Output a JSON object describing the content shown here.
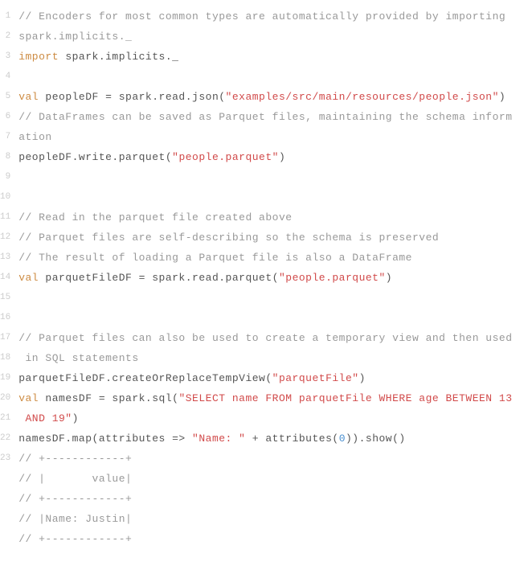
{
  "chart_data": {
    "type": "table",
    "title": "Scala / Spark code snippet",
    "code_lines": [
      {
        "n": 1,
        "segs": [
          {
            "cls": "c-comment",
            "t": "// Encoders for most common types are automatically provided by importing "
          }
        ]
      },
      {
        "n": 2,
        "segs": [
          {
            "cls": "c-comment",
            "t": "spark.implicits._"
          }
        ]
      },
      {
        "n": 3,
        "segs": [
          {
            "cls": "c-keyword",
            "t": "import"
          },
          {
            "cls": "c-plain",
            "t": " spark.implicits._"
          }
        ]
      },
      {
        "n": 4,
        "segs": [
          {
            "cls": "c-plain",
            "t": ""
          }
        ]
      },
      {
        "n": 5,
        "segs": [
          {
            "cls": "c-keyword",
            "t": "val"
          },
          {
            "cls": "c-plain",
            "t": " peopleDF = spark.read.json("
          },
          {
            "cls": "c-string",
            "t": "\"examples/src/main/resources/people.json\""
          },
          {
            "cls": "c-plain",
            "t": ")"
          }
        ]
      },
      {
        "n": 6,
        "segs": [
          {
            "cls": "c-comment",
            "t": "// DataFrames can be saved as Parquet files, maintaining the schema inform"
          }
        ]
      },
      {
        "n": 7,
        "segs": [
          {
            "cls": "c-comment",
            "t": "ation"
          }
        ]
      },
      {
        "n": 8,
        "segs": [
          {
            "cls": "c-plain",
            "t": "peopleDF.write.parquet("
          },
          {
            "cls": "c-string",
            "t": "\"people.parquet\""
          },
          {
            "cls": "c-plain",
            "t": ")"
          }
        ]
      },
      {
        "n": 9,
        "segs": [
          {
            "cls": "c-plain",
            "t": ""
          }
        ]
      },
      {
        "n": 10,
        "segs": [
          {
            "cls": "c-plain",
            "t": ""
          }
        ]
      },
      {
        "n": 11,
        "segs": [
          {
            "cls": "c-comment",
            "t": "// Read in the parquet file created above"
          }
        ]
      },
      {
        "n": 12,
        "segs": [
          {
            "cls": "c-comment",
            "t": "// Parquet files are self-describing so the schema is preserved"
          }
        ]
      },
      {
        "n": 13,
        "segs": [
          {
            "cls": "c-comment",
            "t": "// The result of loading a Parquet file is also a DataFrame"
          }
        ]
      },
      {
        "n": 14,
        "segs": [
          {
            "cls": "c-keyword",
            "t": "val"
          },
          {
            "cls": "c-plain",
            "t": " parquetFileDF = spark.read.parquet("
          },
          {
            "cls": "c-string",
            "t": "\"people.parquet\""
          },
          {
            "cls": "c-plain",
            "t": ")"
          }
        ]
      },
      {
        "n": 15,
        "segs": [
          {
            "cls": "c-plain",
            "t": ""
          }
        ]
      },
      {
        "n": 16,
        "segs": [
          {
            "cls": "c-plain",
            "t": ""
          }
        ]
      },
      {
        "n": 17,
        "segs": [
          {
            "cls": "c-comment",
            "t": "// Parquet files can also be used to create a temporary view and then used"
          }
        ]
      },
      {
        "n": 18,
        "segs": [
          {
            "cls": "c-comment",
            "t": " in SQL statements"
          }
        ]
      },
      {
        "n": 19,
        "segs": [
          {
            "cls": "c-plain",
            "t": "parquetFileDF.createOrReplaceTempView("
          },
          {
            "cls": "c-string",
            "t": "\"parquetFile\""
          },
          {
            "cls": "c-plain",
            "t": ")"
          }
        ]
      },
      {
        "n": 20,
        "segs": [
          {
            "cls": "c-keyword",
            "t": "val"
          },
          {
            "cls": "c-plain",
            "t": " namesDF = spark.sql("
          },
          {
            "cls": "c-string",
            "t": "\"SELECT name FROM parquetFile WHERE age BETWEEN 13"
          }
        ]
      },
      {
        "n": 21,
        "segs": [
          {
            "cls": "c-string",
            "t": " AND 19\""
          },
          {
            "cls": "c-plain",
            "t": ")"
          }
        ]
      },
      {
        "n": 22,
        "segs": [
          {
            "cls": "c-plain",
            "t": "namesDF.map(attributes => "
          },
          {
            "cls": "c-string",
            "t": "\"Name: \""
          },
          {
            "cls": "c-plain",
            "t": " + attributes("
          },
          {
            "cls": "c-number",
            "t": "0"
          },
          {
            "cls": "c-plain",
            "t": ")).show()"
          }
        ]
      },
      {
        "n": 23,
        "segs": [
          {
            "cls": "c-comment",
            "t": "// +------------+"
          }
        ]
      },
      {
        "n": null,
        "segs": [
          {
            "cls": "c-comment",
            "t": "// |       value|"
          }
        ]
      },
      {
        "n": null,
        "segs": [
          {
            "cls": "c-comment",
            "t": "// +------------+"
          }
        ]
      },
      {
        "n": null,
        "segs": [
          {
            "cls": "c-comment",
            "t": "// |Name: Justin|"
          }
        ]
      },
      {
        "n": null,
        "segs": [
          {
            "cls": "c-comment",
            "t": "// +------------+"
          }
        ]
      }
    ]
  }
}
